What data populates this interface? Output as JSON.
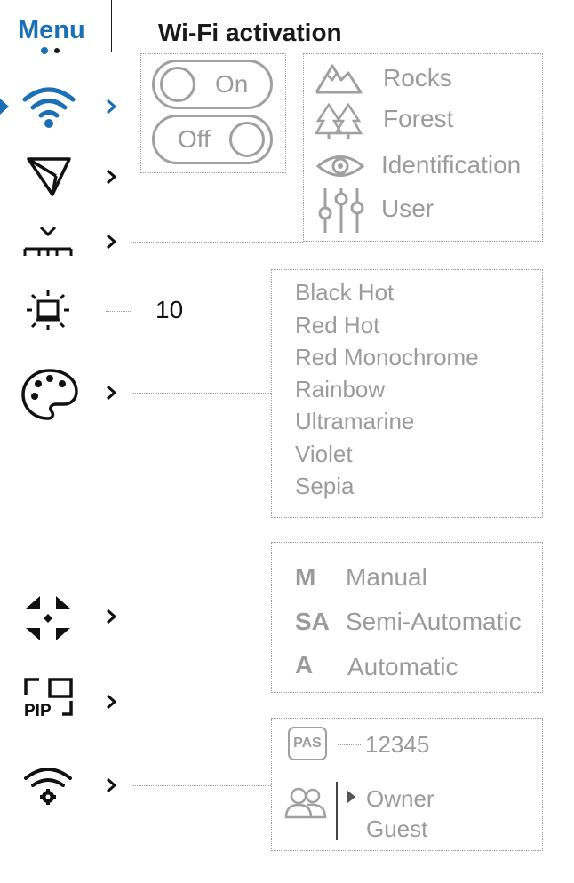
{
  "header": {
    "menu_label": "Menu",
    "title": "Wi-Fi activation"
  },
  "accent_color": "#1a6fb5",
  "wifi_toggle": {
    "on_label": "On",
    "off_label": "Off"
  },
  "scenes": [
    {
      "icon": "mountains-icon",
      "label": "Rocks"
    },
    {
      "icon": "trees-icon",
      "label": "Forest"
    },
    {
      "icon": "eye-icon",
      "label": "Identification"
    },
    {
      "icon": "sliders-icon",
      "label": "User"
    }
  ],
  "auto_shutdown": {
    "value": "10"
  },
  "palettes": [
    "Black Hot",
    "Red Hot",
    "Red Monochrome",
    "Rainbow",
    "Ultramarine",
    "Violet",
    "Sepia"
  ],
  "calibration_modes": [
    {
      "letter": "M",
      "label": "Manual"
    },
    {
      "letter": "SA",
      "label": "Semi-Automatic"
    },
    {
      "letter": "A",
      "label": "Automatic"
    }
  ],
  "wifi_settings": {
    "password_badge": "PAS",
    "password_value": "12345",
    "access_levels": [
      "Owner",
      "Guest"
    ]
  },
  "menu_items": [
    {
      "icon": "wifi-icon",
      "selected": true
    },
    {
      "icon": "paper-plane-icon"
    },
    {
      "icon": "display-off-icon"
    },
    {
      "icon": "auto-shutdown-icon"
    },
    {
      "icon": "palette-icon"
    },
    {
      "icon": "calibration-icon"
    },
    {
      "icon": "pip-icon"
    },
    {
      "icon": "wifi-settings-icon"
    }
  ]
}
